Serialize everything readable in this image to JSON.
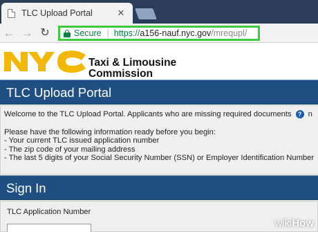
{
  "browser": {
    "tab": {
      "title": "TLC Upload Portal",
      "close_icon": "close-icon"
    },
    "toolbar": {
      "back_icon": "back-arrow-icon",
      "forward_icon": "forward-arrow-icon",
      "reload_icon": "reload-icon",
      "secure_label": "Secure",
      "url_scheme": "https://",
      "url_host": "a156-nauf.nyc.gov",
      "url_path": "/mrequpl/",
      "highlight_color": "#3ec93e"
    }
  },
  "header": {
    "logo_text": "NYC",
    "org_name_line1": "Taxi & Limousine",
    "org_name_line2": "Commission",
    "logo_color": "#f2b705"
  },
  "portal": {
    "title": "TLC Upload Portal",
    "welcome_text": "Welcome to the TLC Upload Portal. Applicants who are missing required documents",
    "welcome_trailing": "n",
    "prep_text": "Please have the following information ready before you begin:",
    "requirements": [
      "- Your current TLC issued application number",
      "- The zip code of your mailing address",
      "- The last 5 digits of your Social Security Number (SSN) or Employer Identification Number"
    ],
    "banner_color": "#1f4f82"
  },
  "signin": {
    "title": "Sign In",
    "application_number_label": "TLC Application Number",
    "application_number_value": ""
  },
  "watermark": {
    "part1": "wiki",
    "part2": "How"
  }
}
